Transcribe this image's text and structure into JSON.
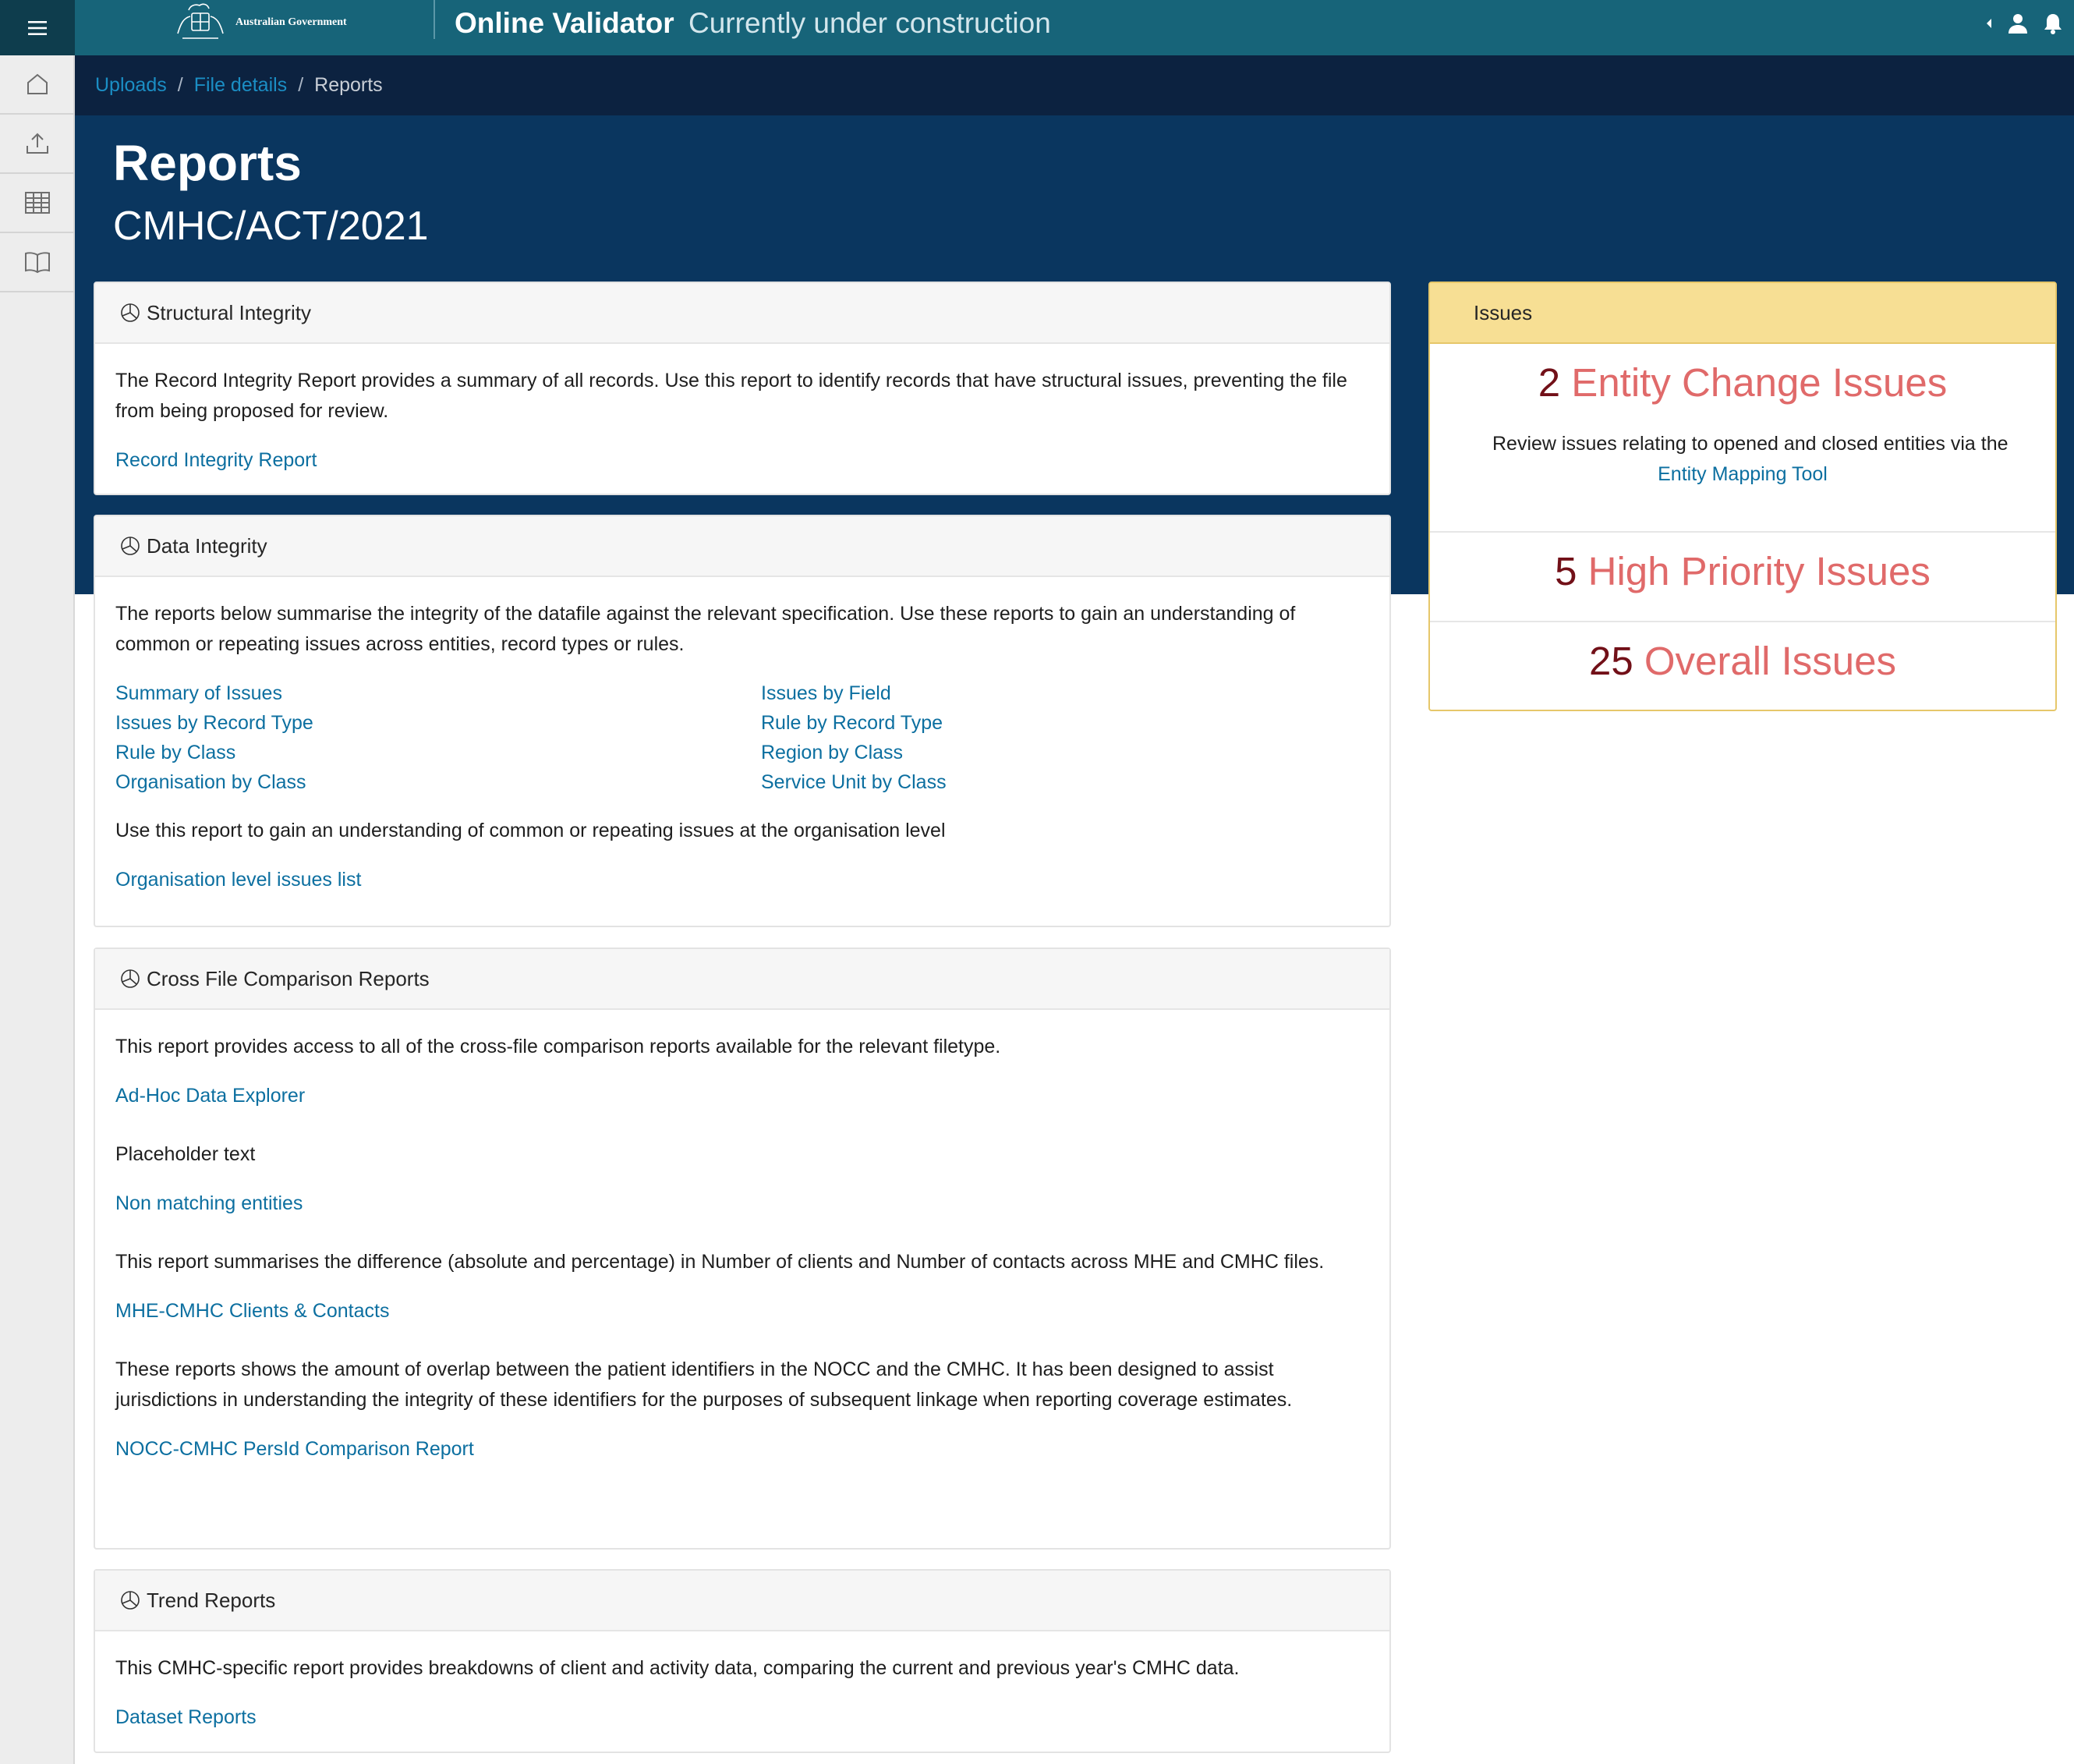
{
  "header": {
    "gov_name": "Australian Government",
    "app_title": "Online Validator",
    "app_subtitle": "Currently under construction"
  },
  "breadcrumb": {
    "items": [
      "Uploads",
      "File details",
      "Reports"
    ]
  },
  "page": {
    "title": "Reports",
    "subtitle": "CMHC/ACT/2021"
  },
  "structural": {
    "heading": "Structural Integrity",
    "description": "The Record Integrity Report provides a summary of all records. Use this report to identify records that have structural issues, preventing the file from being proposed for review.",
    "link": "Record Integrity Report"
  },
  "data_integrity": {
    "heading": "Data Integrity",
    "description": "The reports below summarise the integrity of the datafile against the relevant specification. Use these reports to gain an understanding of common or repeating issues across entities, record types or rules.",
    "links": [
      "Summary of Issues",
      "Issues by Field",
      "Issues by Record Type",
      "Rule by Record Type",
      "Rule by Class",
      "Region by Class",
      "Organisation by Class",
      "Service Unit by Class"
    ],
    "org_description": "Use this report to gain an understanding of common or repeating issues at the organisation level",
    "org_link": "Organisation level issues list"
  },
  "cross_file": {
    "heading": "Cross File Comparison Reports",
    "desc1": "This report provides access to all of the cross-file comparison reports available for the relevant filetype.",
    "link1": "Ad-Hoc Data Explorer",
    "desc2": "Placeholder text",
    "link2": "Non matching entities",
    "desc3": "This report summarises the difference (absolute and percentage) in Number of clients and Number of contacts across MHE and CMHC files.",
    "link3": "MHE-CMHC Clients & Contacts",
    "desc4": "These reports shows the amount of overlap between the patient identifiers in the NOCC and the CMHC. It has been designed to assist jurisdictions in understanding the integrity of these identifiers for the purposes of subsequent linkage when reporting coverage estimates.",
    "link4": "NOCC-CMHC PersId Comparison Report"
  },
  "trend": {
    "heading": "Trend Reports",
    "description": "This CMHC-specific report provides breakdowns of client and activity data, comparing the current and previous year's CMHC data.",
    "link": "Dataset Reports"
  },
  "issues": {
    "heading": "Issues",
    "entity_count": "2",
    "entity_label": "Entity Change Issues",
    "entity_desc": "Review issues relating to opened and closed entities via the",
    "entity_link": "Entity Mapping Tool",
    "high_count": "5",
    "high_label": "High Priority Issues",
    "overall_count": "25",
    "overall_label": "Overall Issues",
    "count_color": "#721018",
    "label_color": "#e06a6a"
  },
  "colors": {
    "topbar": "#176479",
    "breadcrumb_bg": "#0c2240",
    "hero_bg": "#0a365f",
    "link": "#0c6fa0",
    "issues_head": "#f7df94"
  },
  "icons": [
    "menu-icon",
    "home-icon",
    "upload-icon",
    "table-icon",
    "book-icon",
    "caret-left-icon",
    "user-icon",
    "bell-icon",
    "pie-chart-icon",
    "coat-of-arms-icon"
  ]
}
